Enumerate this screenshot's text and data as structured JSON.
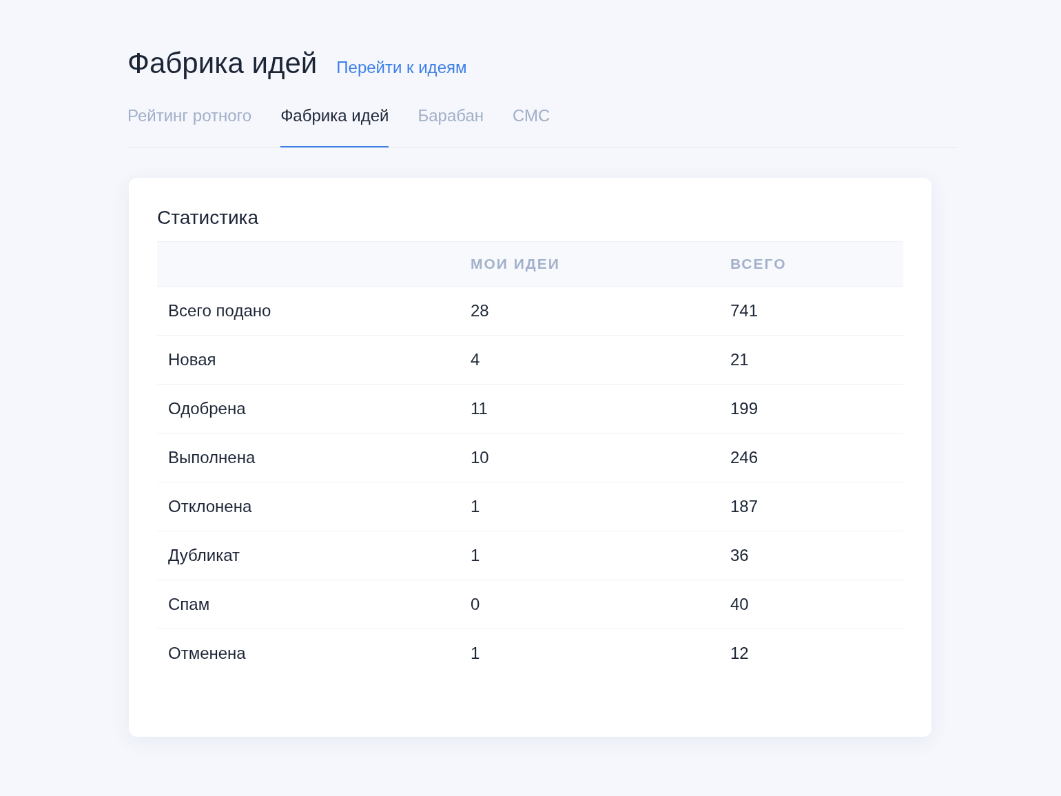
{
  "header": {
    "title": "Фабрика идей",
    "link": "Перейти к идеям"
  },
  "tabs": [
    {
      "label": "Рейтинг ротного",
      "selected": false
    },
    {
      "label": "Фабрика идей",
      "selected": true
    },
    {
      "label": "Барабан",
      "selected": false
    },
    {
      "label": "СМС",
      "selected": false
    }
  ],
  "stats": {
    "title": "Статистика",
    "columns": [
      "МОИ ИДЕИ",
      "ВСЕГО"
    ],
    "rows": [
      {
        "label": "Всего подано",
        "mine": "28",
        "total": "741"
      },
      {
        "label": "Новая",
        "mine": "4",
        "total": "21"
      },
      {
        "label": "Одобрена",
        "mine": "11",
        "total": "199"
      },
      {
        "label": "Выполнена",
        "mine": "10",
        "total": "246"
      },
      {
        "label": "Отклонена",
        "mine": "1",
        "total": "187"
      },
      {
        "label": "Дубликат",
        "mine": "1",
        "total": "36"
      },
      {
        "label": "Спам",
        "mine": "0",
        "total": "40"
      },
      {
        "label": "Отменена",
        "mine": "1",
        "total": "12"
      }
    ]
  }
}
